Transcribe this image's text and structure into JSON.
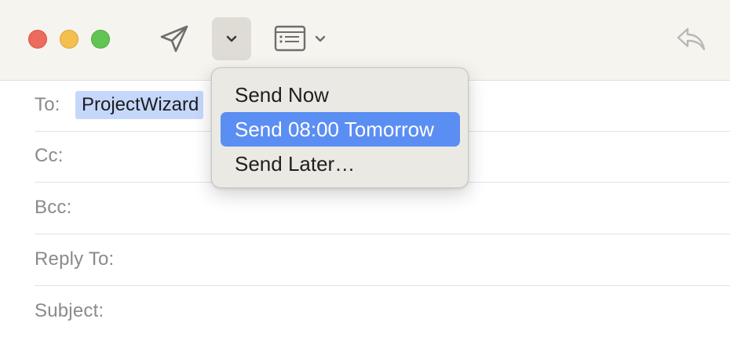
{
  "toolbar": {
    "buttons": {
      "send": "paper-plane-icon",
      "send_options": "chevron-down-icon",
      "format": "header-fields-icon",
      "reply": "reply-arrow-icon"
    }
  },
  "fields": {
    "to_label": "To:",
    "to_recipient": "ProjectWizard",
    "cc_label": "Cc:",
    "bcc_label": "Bcc:",
    "reply_to_label": "Reply To:",
    "subject_label": "Subject:"
  },
  "send_menu": {
    "items": [
      {
        "label": "Send Now",
        "selected": false
      },
      {
        "label": "Send 08:00 Tomorrow",
        "selected": true
      },
      {
        "label": "Send Later…",
        "selected": false
      }
    ]
  },
  "colors": {
    "accent": "#5b8ef2",
    "recipient_token": "#c5d8fb",
    "toolbar_bg": "#f6f4ee",
    "traffic_close": "#ed6a5e",
    "traffic_minimize": "#f5bf4f",
    "traffic_maximize": "#61c554"
  }
}
